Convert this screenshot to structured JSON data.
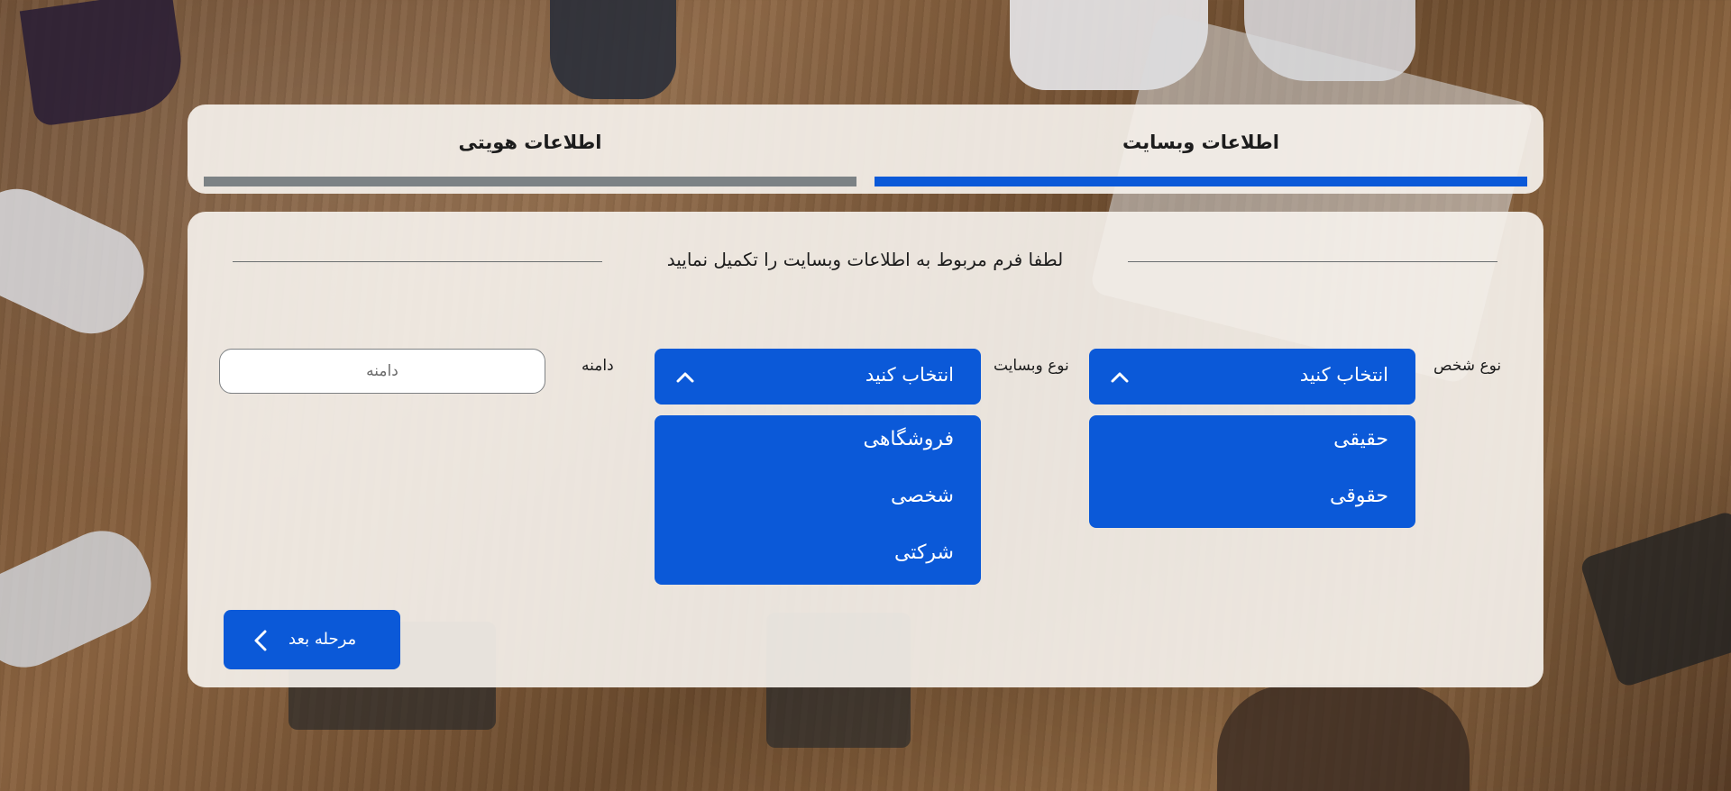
{
  "steps": [
    {
      "label": "اطلاعات وبسایت",
      "status": "active",
      "color": "#0b59d8"
    },
    {
      "label": "اطلاعات هویتی",
      "status": "inactive",
      "color": "#7c8285"
    }
  ],
  "form": {
    "heading": "لطفا فرم مربوط به اطلاعات وبسایت را تکمیل نمایید",
    "person_type": {
      "label": "نوع شخص",
      "selected": "انتخاب کنید",
      "options": [
        "حقیقی",
        "حقوقی"
      ]
    },
    "website_type": {
      "label": "نوع وبسایت",
      "selected": "انتخاب کنید",
      "options": [
        "فروشگاهی",
        "شخصی",
        "شرکتی"
      ]
    },
    "domain": {
      "label": "دامنه",
      "placeholder": "دامنه",
      "value": ""
    },
    "next_button": {
      "label": "مرحله بعد",
      "icon": "chevron-left-icon"
    }
  },
  "colors": {
    "accent": "#0b59d8",
    "inactive_bar": "#7c8285",
    "panel": "#f5f1ec"
  }
}
